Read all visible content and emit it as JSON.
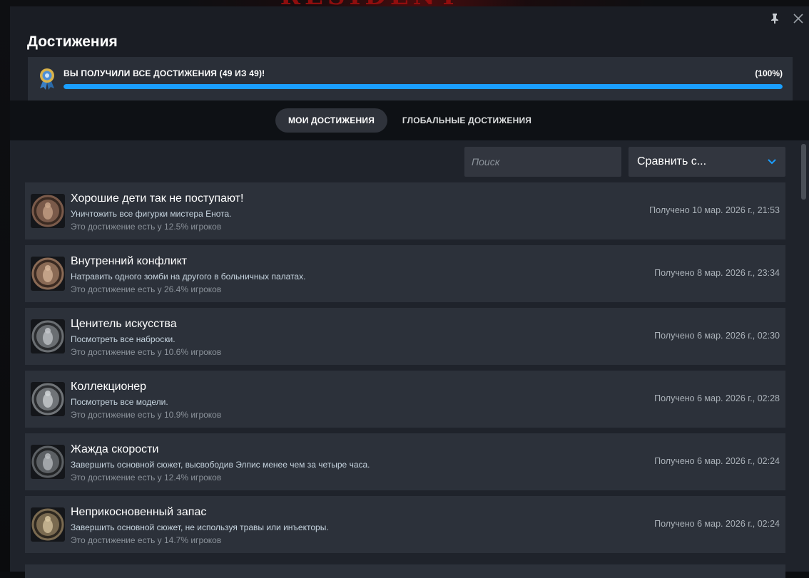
{
  "background": {
    "title": "RESIDENT EVIL"
  },
  "window": {
    "pin_icon": "pin-icon",
    "close_icon": "close-icon"
  },
  "header": {
    "title": "Достижения"
  },
  "progress": {
    "label": "ВЫ ПОЛУЧИЛИ ВСЕ ДОСТИЖЕНИЯ (49 ИЗ 49)!",
    "percent_label": "(100%)",
    "fraction": 1.0,
    "bar_color": "#1a9fff"
  },
  "tabs": [
    {
      "label": "МОИ ДОСТИЖЕНИЯ",
      "active": true
    },
    {
      "label": "ГЛОБАЛЬНЫЕ ДОСТИЖЕНИЯ",
      "active": false
    }
  ],
  "search": {
    "placeholder": "Поиск",
    "value": ""
  },
  "compare": {
    "label": "Сравнить с...",
    "accent": "#1a9fff"
  },
  "achievements": [
    {
      "name": "Хорошие дети так не поступают!",
      "desc": "Уничтожить все фигурки мистера Енота.",
      "rarity": "Это достижение есть у 12.5% игроков",
      "date": "Получено 10 мар. 2026 г., 21:53",
      "icon": "raccoon-figurine-icon"
    },
    {
      "name": "Внутренний конфликт",
      "desc": "Натравить одного зомби на другого в больничных палатах.",
      "rarity": "Это достижение есть у 26.4% игроков",
      "date": "Получено 8 мар. 2026 г., 23:34",
      "icon": "zombie-patient-icon"
    },
    {
      "name": "Ценитель искусства",
      "desc": "Посмотреть все наброски.",
      "rarity": "Это достижение есть у 10.6% игроков",
      "date": "Получено 6 мар. 2026 г., 02:30",
      "icon": "picture-frame-icon"
    },
    {
      "name": "Коллекционер",
      "desc": "Посмотреть все модели.",
      "rarity": "Это достижение есть у 10.9% игроков",
      "date": "Получено 6 мар. 2026 г., 02:28",
      "icon": "figure-bust-icon"
    },
    {
      "name": "Жажда скорости",
      "desc": "Завершить основной сюжет, высвободив Элпис менее чем за четыре часа.",
      "rarity": "Это достижение есть у 12.4% игроков",
      "date": "Получено 6 мар. 2026 г., 02:24",
      "icon": "timer-icon"
    },
    {
      "name": "Неприкосновенный запас",
      "desc": "Завершить основной сюжет, не используя травы или инъекторы.",
      "rarity": "Это достижение есть у 14.7% игроков",
      "date": "Получено 6 мар. 2026 г., 02:24",
      "icon": "herb-icon"
    }
  ]
}
